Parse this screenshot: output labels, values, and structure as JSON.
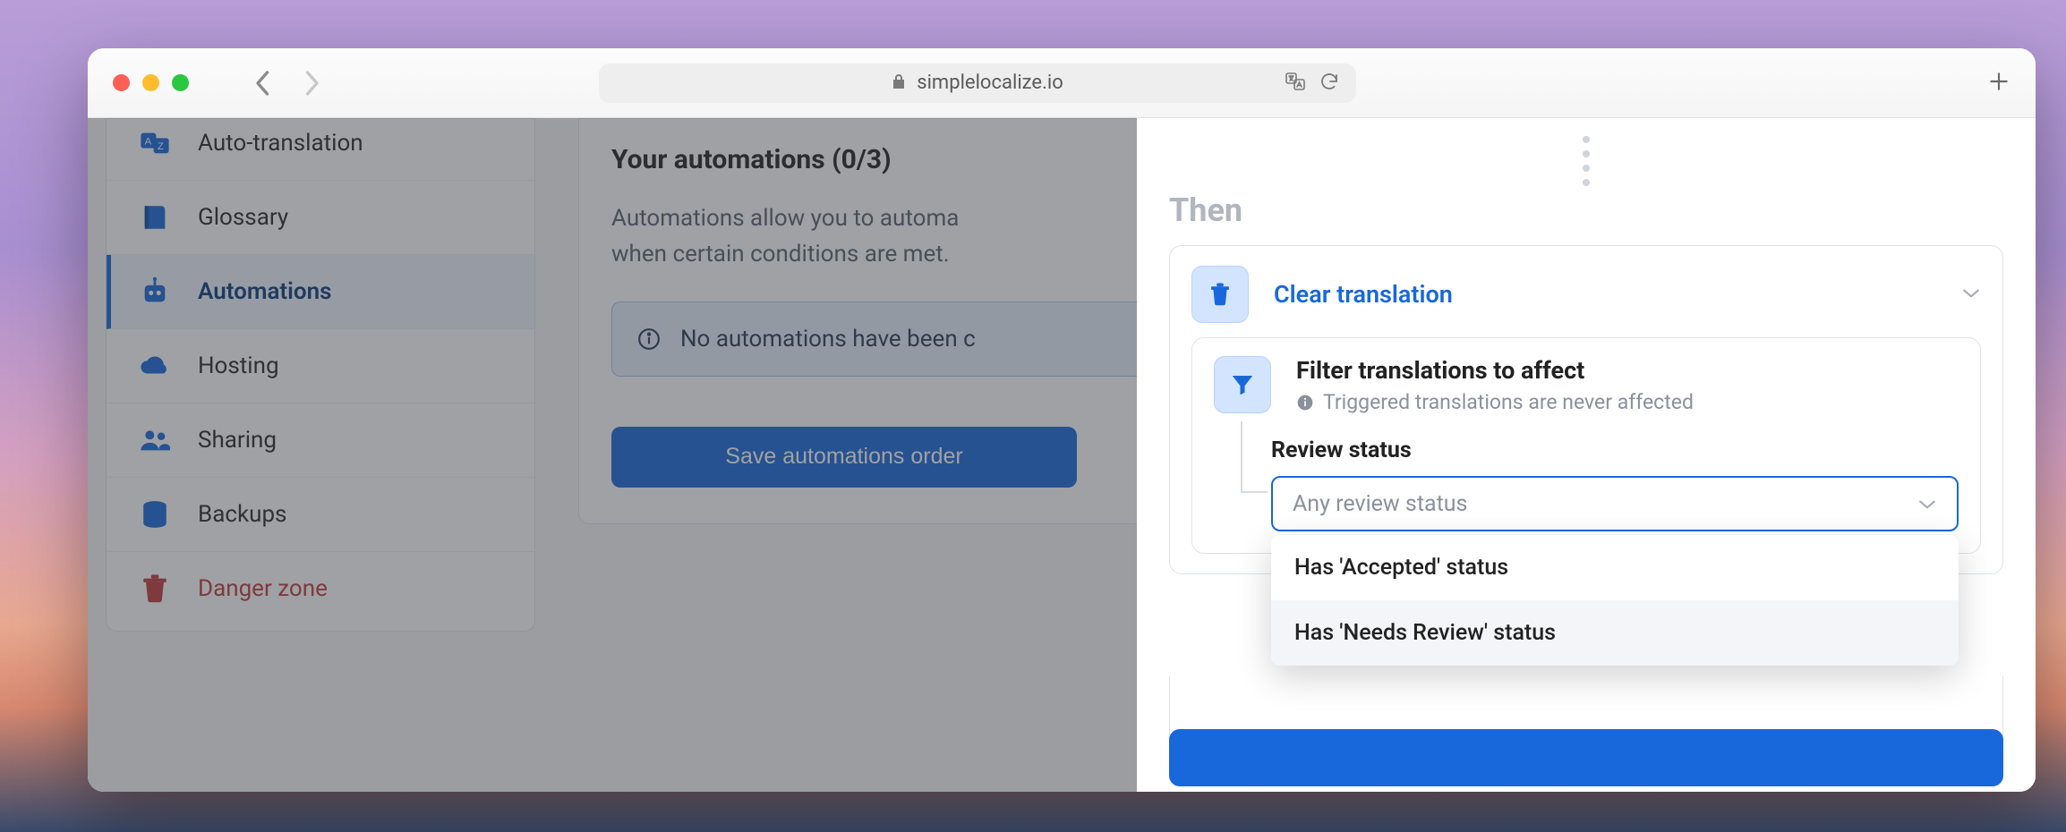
{
  "browser": {
    "url": "simplelocalize.io"
  },
  "sidebar": {
    "items": [
      {
        "label": "Auto-translation"
      },
      {
        "label": "Glossary"
      },
      {
        "label": "Automations"
      },
      {
        "label": "Hosting"
      },
      {
        "label": "Sharing"
      },
      {
        "label": "Backups"
      },
      {
        "label": "Danger zone"
      }
    ]
  },
  "main": {
    "title": "Your automations (0/3)",
    "desc_line1": "Automations allow you to automa",
    "desc_line2": "when certain conditions are met.",
    "banner": "No automations have been c",
    "save_label": "Save automations order"
  },
  "popover": {
    "then_label": "Then",
    "action_title": "Clear translation",
    "filter_title": "Filter translations to affect",
    "filter_sub": "Triggered translations are never affected",
    "review_label": "Review status",
    "select_placeholder": "Any review status",
    "options": [
      "Has 'Accepted' status",
      "Has 'Needs Review' status"
    ]
  }
}
